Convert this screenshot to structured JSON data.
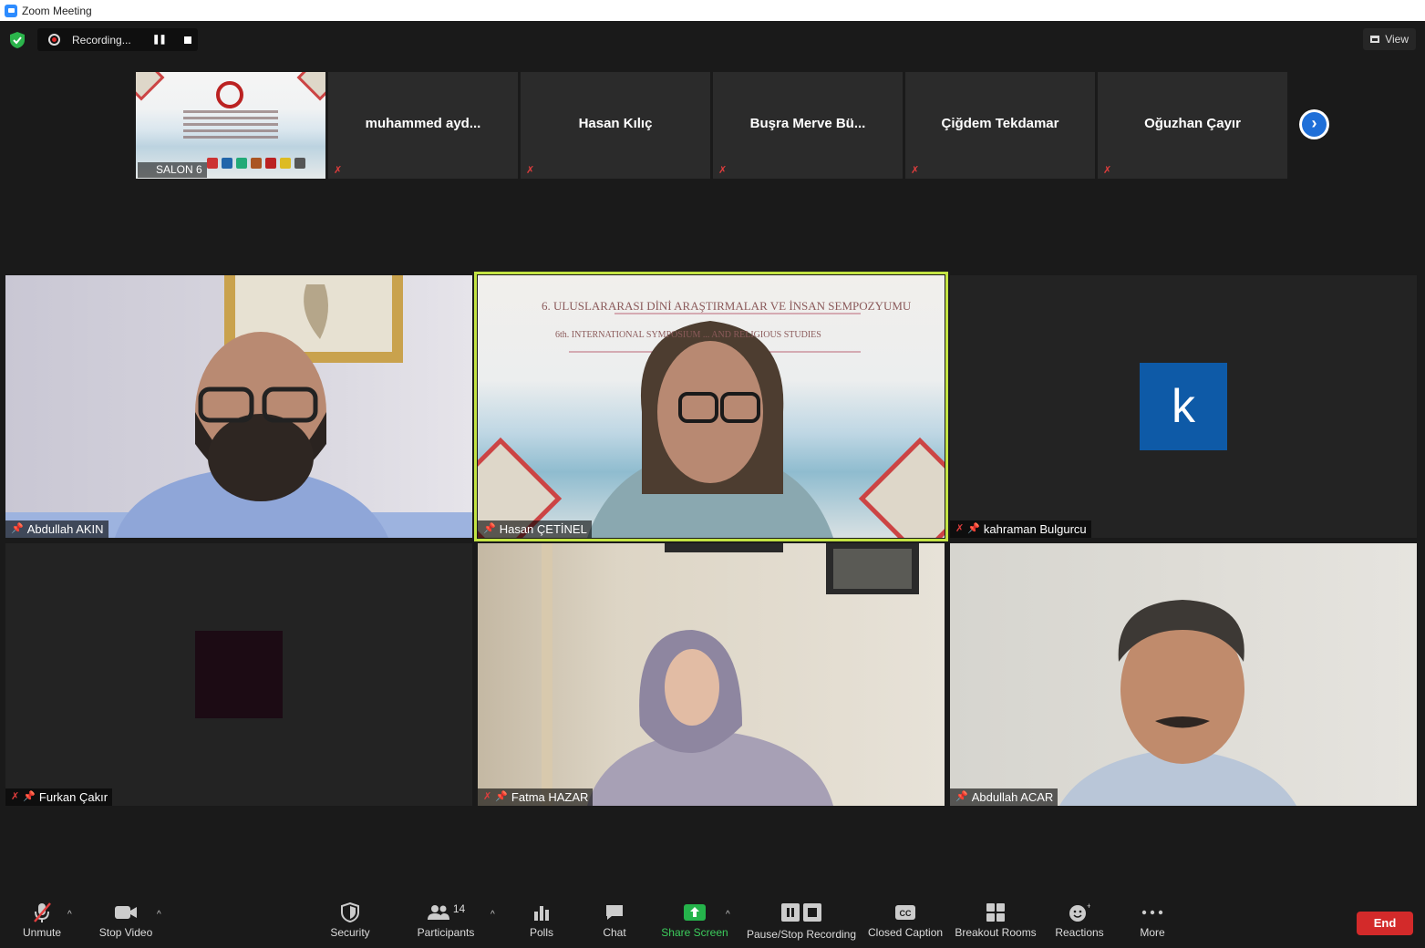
{
  "window": {
    "title": "Zoom Meeting"
  },
  "topbar": {
    "recording_label": "Recording...",
    "view_label": "View"
  },
  "strip": {
    "salon_label": "SALON 6",
    "participants": [
      "muhammed  ayd...",
      "Hasan Kılıç",
      "Buşra Merve Bü...",
      "Çiğdem Tekdamar",
      "Oğuzhan Çayır"
    ]
  },
  "gallery": {
    "tiles": [
      {
        "name": "Abdullah AKIN",
        "muted": false
      },
      {
        "name": "Hasan ÇETİNEL",
        "muted": false,
        "active_speaker": true
      },
      {
        "name": "kahraman Bulgurcu",
        "muted": true,
        "avatar_letter": "k"
      },
      {
        "name": "Furkan Çakır",
        "muted": true
      },
      {
        "name": "Fatma HAZAR",
        "muted": true
      },
      {
        "name": "Abdullah ACAR",
        "muted": false
      }
    ],
    "banner_lines": [
      "6. ULUSLARARASI DİNİ ARAŞTIRMALAR VE İNSAN SEMPOZYUMU",
      "6th. INTERNATIONAL SYMPOSIUM ... AND RELIGIOUS STUDIES"
    ]
  },
  "toolbar": {
    "unmute": "Unmute",
    "stop_video": "Stop Video",
    "security": "Security",
    "participants": "Participants",
    "participants_count": "14",
    "polls": "Polls",
    "chat": "Chat",
    "share_screen": "Share Screen",
    "pause_stop_recording": "Pause/Stop Recording",
    "closed_caption": "Closed Caption",
    "breakout_rooms": "Breakout Rooms",
    "reactions": "Reactions",
    "more": "More",
    "end": "End"
  },
  "colors": {
    "accent_blue": "#1f6fd8",
    "end_red": "#d32a2a",
    "share_green": "#25b34b",
    "active_border": "#c3e343",
    "avatar_blue": "#0e5aa7"
  }
}
